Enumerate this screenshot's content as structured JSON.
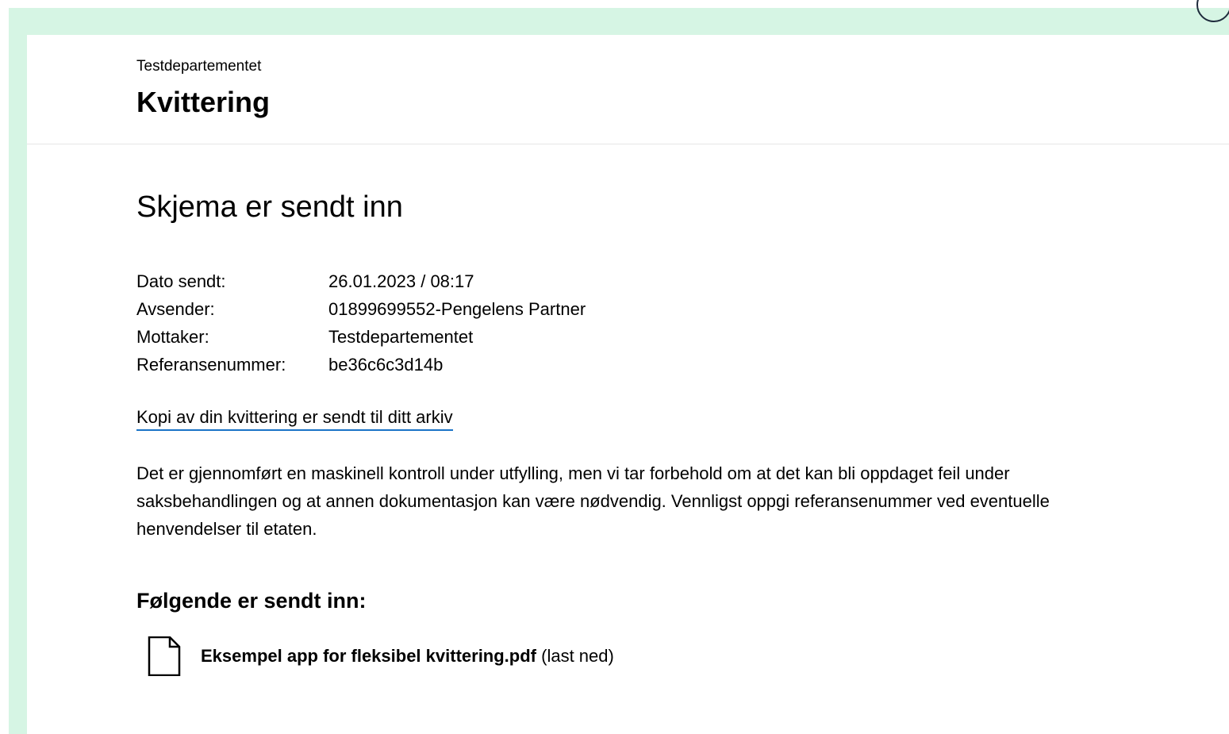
{
  "header": {
    "organization": "Testdepartementet",
    "title": "Kvittering"
  },
  "receipt": {
    "heading": "Skjema er sendt inn",
    "fields": [
      {
        "label": "Dato sendt:",
        "value": "26.01.2023 / 08:17"
      },
      {
        "label": "Avsender:",
        "value": "01899699552-Pengelens Partner"
      },
      {
        "label": "Mottaker:",
        "value": "Testdepartementet"
      },
      {
        "label": "Referansenummer:",
        "value": "be36c6c3d14b"
      }
    ],
    "archive_link": "Kopi av din kvittering er sendt til ditt arkiv",
    "disclaimer": "Det er gjennomført en maskinell kontroll under utfylling, men vi tar forbehold om at det kan bli oppdaget feil under saksbehandlingen og at annen dokumentasjon kan være nødvendig. Vennligst oppgi referansenummer ved eventuelle henvendelser til etaten."
  },
  "attachments": {
    "heading": "Følgende er sendt inn:",
    "items": [
      {
        "file_name": "Eksempel app for fleksibel kvittering.pdf",
        "download_label": "(last ned)",
        "icon": "file-icon"
      }
    ]
  },
  "colors": {
    "backdrop": "#d6f5e4",
    "link_underline": "#1a73c7",
    "text": "#000000"
  }
}
